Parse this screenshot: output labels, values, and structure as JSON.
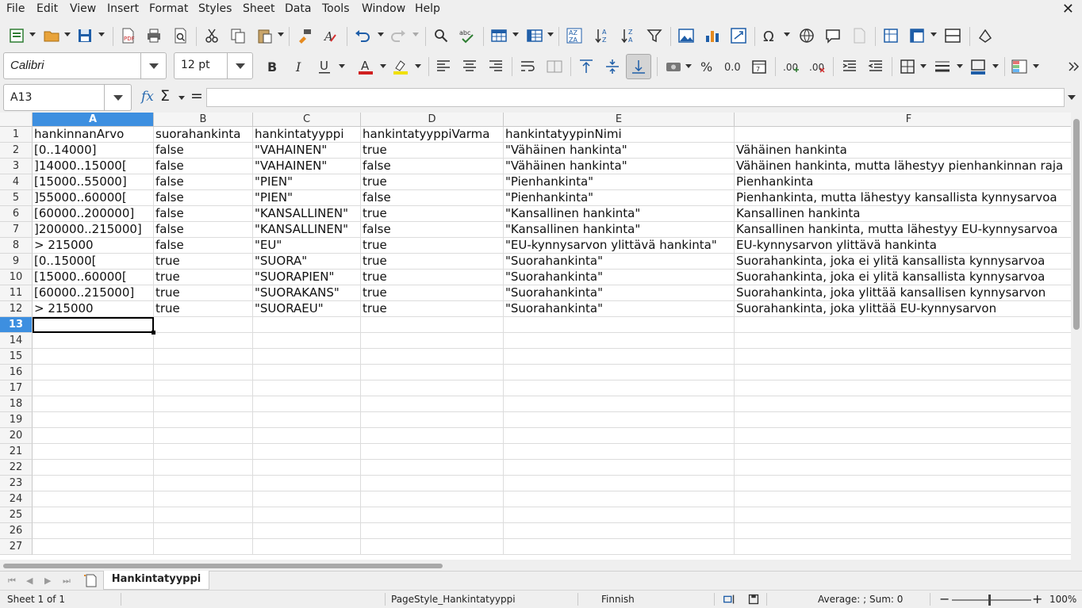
{
  "menu": [
    "File",
    "Edit",
    "View",
    "Insert",
    "Format",
    "Styles",
    "Sheet",
    "Data",
    "Tools",
    "Window",
    "Help"
  ],
  "window": {
    "close_glyph": "✕"
  },
  "format_toolbar": {
    "font_name": "Calibri",
    "font_size": "12 pt"
  },
  "formula_bar": {
    "cell_ref": "A13",
    "fx_glyph": "𝑓x",
    "sum_glyph": "Σ",
    "equals_glyph": "=",
    "content": ""
  },
  "columns": [
    {
      "letter": "A",
      "selected": true
    },
    {
      "letter": "B",
      "selected": false
    },
    {
      "letter": "C",
      "selected": false
    },
    {
      "letter": "D",
      "selected": false
    },
    {
      "letter": "E",
      "selected": false
    },
    {
      "letter": "F",
      "selected": false
    }
  ],
  "rows": [
    [
      "hankinnanArvo",
      "suorahankinta",
      "hankintatyyppi",
      "hankintatyyppiVarma",
      "hankintatyypinNimi",
      ""
    ],
    [
      "[0..14000]",
      "false",
      "\"VAHAINEN\"",
      "true",
      "\"Vähäinen hankinta\"",
      "Vähäinen hankinta"
    ],
    [
      "]14000..15000[",
      "false",
      "\"VAHAINEN\"",
      "false",
      "\"Vähäinen hankinta\"",
      "Vähäinen hankinta, mutta lähestyy pienhankinnan raja"
    ],
    [
      "[15000..55000]",
      "false",
      "\"PIEN\"",
      "true",
      "\"Pienhankinta\"",
      "Pienhankinta"
    ],
    [
      "]55000..60000[",
      "false",
      "\"PIEN\"",
      "false",
      "\"Pienhankinta\"",
      "Pienhankinta, mutta lähestyy kansallista kynnysarvoa"
    ],
    [
      "[60000..200000]",
      "false",
      "\"KANSALLINEN\"",
      "true",
      "\"Kansallinen hankinta\"",
      "Kansallinen hankinta"
    ],
    [
      "]200000..215000]",
      "false",
      "\"KANSALLINEN\"",
      "false",
      "\"Kansallinen hankinta\"",
      "Kansallinen hankinta, mutta lähestyy EU-kynnysarvoa"
    ],
    [
      "> 215000",
      "false",
      "\"EU\"",
      "true",
      "\"EU-kynnysarvon ylittävä hankinta\"",
      "EU-kynnysarvon ylittävä hankinta"
    ],
    [
      "[0..15000[",
      "true",
      "\"SUORA\"",
      "true",
      "\"Suorahankinta\"",
      "Suorahankinta, joka ei ylitä kansallista kynnysarvoa"
    ],
    [
      "[15000..60000[",
      "true",
      "\"SUORAPIEN\"",
      "true",
      "\"Suorahankinta\"",
      "Suorahankinta, joka ei ylitä kansallista kynnysarvoa"
    ],
    [
      "[60000..215000]",
      "true",
      "\"SUORAKANS\"",
      "true",
      "\"Suorahankinta\"",
      "Suorahankinta, joka ylittää kansallisen kynnysarvon"
    ],
    [
      "> 215000",
      "true",
      "\"SUORAEU\"",
      "true",
      "\"Suorahankinta\"",
      "Suorahankinta, joka ylittää EU-kynnysarvon"
    ]
  ],
  "row_numbers": [
    "1",
    "2",
    "3",
    "4",
    "5",
    "6",
    "7",
    "8",
    "9",
    "10",
    "11",
    "12",
    "13",
    "14",
    "15",
    "16",
    "17",
    "18",
    "19",
    "20",
    "21",
    "22",
    "23",
    "24",
    "25",
    "26",
    "27"
  ],
  "selected_row": "13",
  "sheet_tab": "Hankintatyyppi",
  "status": {
    "sheet": "Sheet 1 of 1",
    "page_style": "PageStyle_Hankintatyyppi",
    "language": "Finnish",
    "summary": "Average: ; Sum: 0",
    "zoom": "100%"
  },
  "colors": {
    "selection_header": "#3d8fe0",
    "font_color_bar": "#d02020",
    "highlight_bar": "#f0e000"
  }
}
